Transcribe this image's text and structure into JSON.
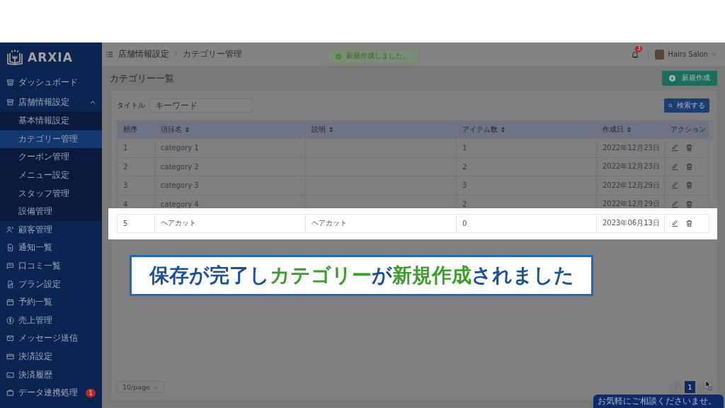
{
  "sidebar": {
    "logo": "ARXIA",
    "items": [
      {
        "label": "ダッシュボード",
        "selected": false
      },
      {
        "label": "店舗情報設定",
        "selected": false,
        "expanded": true,
        "children": [
          {
            "label": "基本情報設定",
            "selected": false
          },
          {
            "label": "カテゴリー管理",
            "selected": true
          },
          {
            "label": "クーポン管理",
            "selected": false
          },
          {
            "label": "メニュー設定",
            "selected": false
          },
          {
            "label": "スタッフ管理",
            "selected": false
          },
          {
            "label": "設備管理",
            "selected": false
          }
        ]
      },
      {
        "label": "顧客管理",
        "selected": false
      },
      {
        "label": "通知一覧",
        "selected": false
      },
      {
        "label": "口コミ一覧",
        "selected": false
      },
      {
        "label": "プラン設定",
        "selected": false
      },
      {
        "label": "予約一覧",
        "selected": false
      },
      {
        "label": "売上管理",
        "selected": false
      },
      {
        "label": "メッセージ送信",
        "selected": false
      },
      {
        "label": "決済設定",
        "selected": false
      },
      {
        "label": "決済履歴",
        "selected": false
      },
      {
        "label": "データ連携処理",
        "selected": false,
        "badge": "1"
      }
    ]
  },
  "header": {
    "breadcrumbs": [
      "店舗情報設定",
      "カテゴリー管理"
    ],
    "toast": "新規作成しました。",
    "notification_count": "3",
    "user_name": "Hairs Salon"
  },
  "page": {
    "title": "カテゴリー一覧",
    "new_button": "新規作成"
  },
  "filter": {
    "label": "タイトル",
    "placeholder": "キーワード",
    "search_button": "検索する"
  },
  "table": {
    "columns": [
      {
        "label": "順序",
        "sortable": false
      },
      {
        "label": "項目名",
        "sortable": true
      },
      {
        "label": "説明",
        "sortable": true
      },
      {
        "label": "アイテム数",
        "sortable": true
      },
      {
        "label": "作成日",
        "sortable": true
      },
      {
        "label": "アクション",
        "sortable": false
      }
    ],
    "rows": [
      {
        "order": "1",
        "name": "category 1",
        "item_count": "1",
        "created": "2022年12月23日",
        "highlighted": false
      },
      {
        "order": "2",
        "name": "category 2",
        "item_count": "2",
        "created": "2022年12月23日",
        "highlighted": false
      },
      {
        "order": "3",
        "name": "category 3",
        "item_count": "3",
        "created": "2022年12月29日",
        "highlighted": false
      },
      {
        "order": "4",
        "name": "category 4",
        "item_count": "2",
        "created": "2022年12月29日",
        "highlighted": false
      },
      {
        "order": "5",
        "name": "ヘアカット",
        "description": "ヘアカット",
        "item_count": "0",
        "created": "2023年06月13日",
        "highlighted": true
      }
    ]
  },
  "pagination": {
    "page_size": "10/page",
    "pages": [
      {
        "label": "1",
        "selected": true
      }
    ]
  },
  "chat": {
    "text": "お気軽にご相談くださいませ。"
  },
  "caption": {
    "segments": [
      {
        "text": "保存が完了し",
        "color": "#1c4f9c"
      },
      {
        "text": "カテゴリー",
        "color": "#3a9e2a"
      },
      {
        "text": "が",
        "color": "#1c4f9c"
      },
      {
        "text": "新規作成",
        "color": "#3a9e2a"
      },
      {
        "text": "されました",
        "color": "#1c4f9c"
      }
    ]
  }
}
